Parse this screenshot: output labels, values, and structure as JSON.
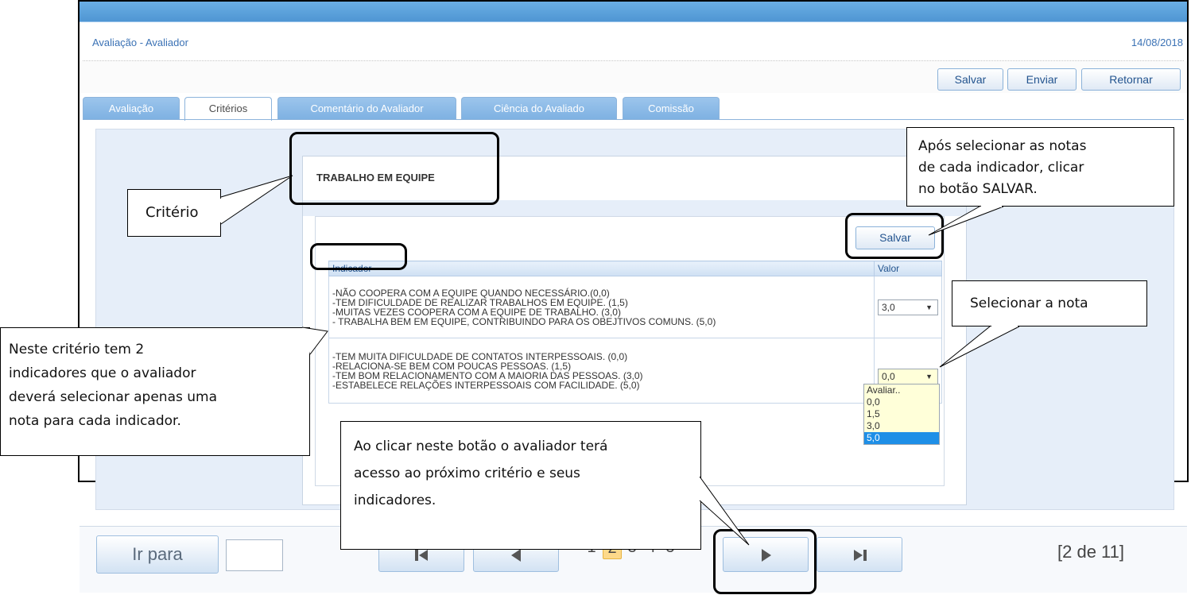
{
  "app": {
    "title": "Avaliação - Avaliador",
    "date": "14/08/2018"
  },
  "actions": {
    "save": "Salvar",
    "send": "Enviar",
    "back": "Retornar"
  },
  "tabs": [
    "Avaliação",
    "Critérios",
    "Comentário do Avaliador",
    "Ciência do Avaliado",
    "Comissão"
  ],
  "criterion": {
    "title": "TRABALHO EM EQUIPE"
  },
  "panel": {
    "save_label": "Salvar"
  },
  "table": {
    "headers": {
      "indicator": "Indicador",
      "value": "Valor"
    },
    "rows": [
      {
        "lines": [
          "-NÃO COOPERA COM A EQUIPE QUANDO NECESSÁRIO.(0,0)",
          "-TEM DIFICULDADE DE REALIZAR TRABALHOS EM EQUIPE. (1,5)",
          "-MUITAS VEZES COOPERA COM A EQUIPE DE TRABALHO. (3,0)",
          "- TRABALHA BEM EM EQUIPE, CONTRIBUINDO PARA OS OBEJTIVOS COMUNS. (5,0)"
        ],
        "value": "3,0"
      },
      {
        "lines": [
          "-TEM MUITA DIFICULDADE DE CONTATOS INTERPESSOAIS. (0,0)",
          "-RELACIONA-SE BEM COM POUCAS PESSOAS. (1,5)",
          "-TEM BOM RELACIONAMENTO COM A MAIORIA DAS PESSOAS. (3,0)",
          "-ESTABELECE RELAÇÕES INTERPESSOAIS COM FACILIDADE. (5,0)"
        ],
        "value": "0,0"
      }
    ],
    "dropdown_options": [
      "Avaliar..",
      "0,0",
      "1,5",
      "3,0",
      "5,0"
    ],
    "dropdown_highlighted": "5,0"
  },
  "footer": {
    "goto_label": "Ir para",
    "goto_value": "",
    "pages": [
      "1",
      "2",
      "3",
      "4",
      "5"
    ],
    "current_page": "2",
    "position": "[2 de 11]"
  },
  "annotations": {
    "criterio": "Critério",
    "salvar_tip": [
      "Após selecionar as notas",
      "de cada indicador, clicar",
      "no botão SALVAR."
    ],
    "nota_tip": "Selecionar a nota",
    "indicadores_tip": [
      "Neste critério tem 2",
      "indicadores que o avaliador",
      "deverá selecionar apenas uma",
      "nota para cada indicador."
    ],
    "proximo_tip": [
      "Ao clicar neste botão o avaliador terá",
      "acesso ao próximo critério e seus",
      "indicadores."
    ]
  }
}
